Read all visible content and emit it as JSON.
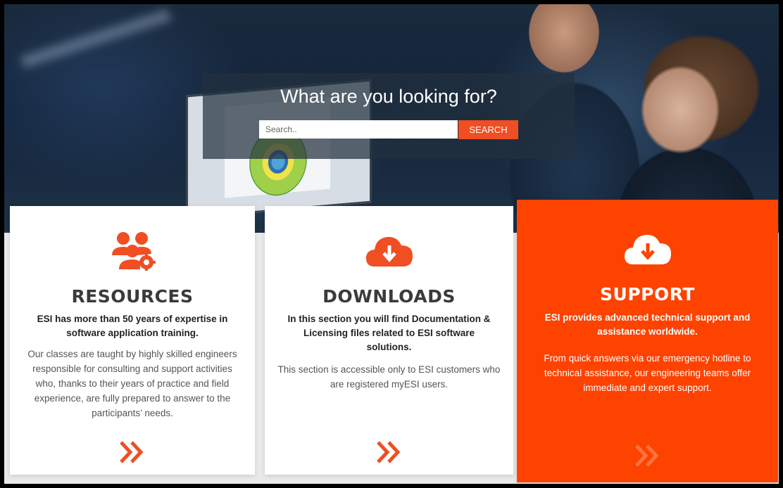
{
  "hero": {
    "title": "What are you looking for?",
    "search": {
      "placeholder": "Search..",
      "button_label": "SEARCH"
    }
  },
  "cards": {
    "resources": {
      "icon": "users-gear-icon",
      "title": "RESOURCES",
      "lead": "ESI has more than 50 years of expertise in software application training.",
      "body": "Our classes are taught by highly skilled engineers responsible for consulting and support activities who, thanks to their years of practice and field experience, are fully prepared to answer to the participants’ needs.",
      "link_icon": "double-chevron-right-icon"
    },
    "downloads": {
      "icon": "cloud-download-icon",
      "title": "DOWNLOADS",
      "lead": "In this section you will find Documentation & Licensing files related to ESI software solutions.",
      "body": "This section is accessible only to ESI customers who are registered myESI users.",
      "link_icon": "double-chevron-right-icon"
    },
    "support": {
      "icon": "cloud-download-icon",
      "title": "SUPPORT",
      "lead": "ESI provides advanced technical support and assistance worldwide.",
      "body": "From quick answers via our emergency hotline to technical assistance, our engineering teams offer immediate and expert support.",
      "link_icon": "double-chevron-right-icon"
    }
  },
  "colors": {
    "accent": "#f04e23",
    "support_bg": "#fe4200",
    "heading": "#3a3a3a"
  }
}
